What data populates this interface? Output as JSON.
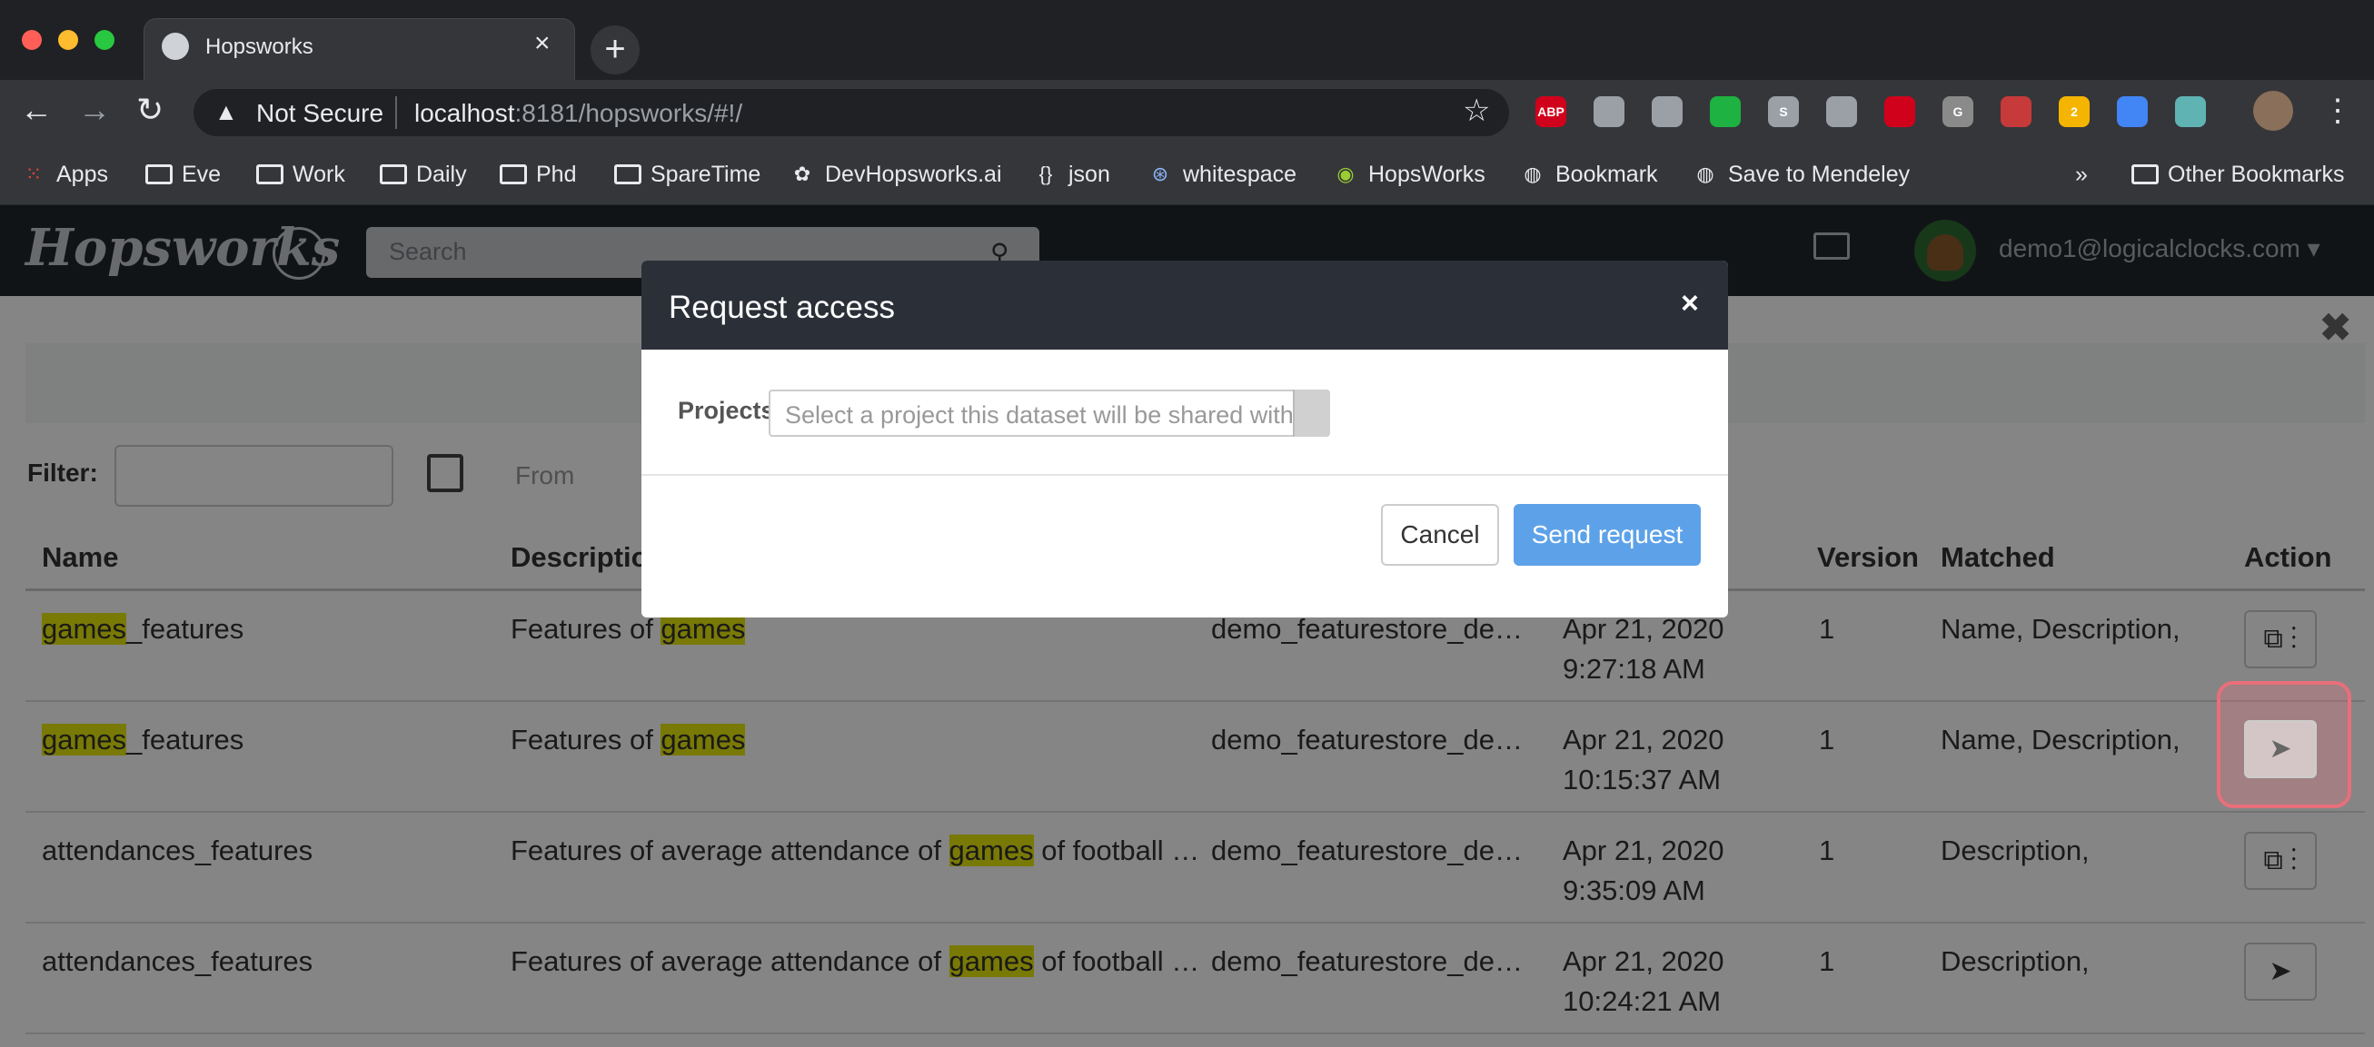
{
  "browser": {
    "tab_title": "Hopsworks",
    "tab_close": "×",
    "new_tab": "+",
    "security": "Not Secure",
    "url_host": "localhost",
    "url_path": ":8181/hopsworks/#!/",
    "extensions": [
      {
        "name": "adblock-icon",
        "text": "ABP",
        "color": "#d0021b"
      },
      {
        "name": "briefcase-icon",
        "text": "",
        "color": "#9aa0a6"
      },
      {
        "name": "dropbox-icon",
        "text": "",
        "color": "#9aa0a6"
      },
      {
        "name": "evernote-icon",
        "text": "",
        "color": "#1db241"
      },
      {
        "name": "skype-icon",
        "text": "S",
        "color": "#9aa0a6"
      },
      {
        "name": "lightbulb-icon",
        "text": "",
        "color": "#9aa0a6"
      },
      {
        "name": "mendeley-icon",
        "text": "",
        "color": "#d0021b"
      },
      {
        "name": "grammar-icon",
        "text": "G",
        "color": "#8a8a8a"
      },
      {
        "name": "tool-icon",
        "text": "",
        "color": "#c73a3a"
      },
      {
        "name": "notes-icon",
        "text": "2",
        "color": "#f4b400"
      },
      {
        "name": "shield-icon",
        "text": "",
        "color": "#4285f4"
      },
      {
        "name": "network-icon",
        "text": "",
        "color": "#5fb3b3"
      }
    ]
  },
  "bookmarks": {
    "items": [
      "Apps",
      "Eve",
      "Work",
      "Daily",
      "Phd",
      "SpareTime",
      "DevHopsworks.ai",
      "json",
      "whitespace",
      "HopsWorks",
      "Bookmark",
      "Save to Mendeley"
    ],
    "more": "»",
    "other": "Other Bookmarks"
  },
  "app": {
    "logo": "Hopsworks",
    "search_placeholder": "Search",
    "user_email": "demo1@logicalclocks.com ▾"
  },
  "filter": {
    "label": "Filter:",
    "from_placeholder": "From"
  },
  "table": {
    "headers": {
      "name": "Name",
      "description": "Description",
      "version": "Version",
      "matched": "Matched",
      "action": "Action"
    },
    "rows": [
      {
        "name_hl": "games",
        "name_rest": "_features",
        "desc_pre": "Features of ",
        "desc_hl": "games",
        "desc_post": "",
        "featurestore": "demo_featurestore_de…",
        "date": "Apr 21, 2020",
        "time": "9:27:18 AM",
        "version": "1",
        "matched": "Name, Description,",
        "action": "⧉ ⋮"
      },
      {
        "name_hl": "games",
        "name_rest": "_features",
        "desc_pre": "Features of ",
        "desc_hl": "games",
        "desc_post": "",
        "featurestore": "demo_featurestore_de…",
        "date": "Apr 21, 2020",
        "time": "10:15:37 AM",
        "version": "1",
        "matched": "Name, Description,",
        "action": "➤"
      },
      {
        "name_hl": "",
        "name_rest": "attendances_features",
        "desc_pre": "Features of average attendance of ",
        "desc_hl": "games",
        "desc_post": " of football …",
        "featurestore": "demo_featurestore_de…",
        "date": "Apr 21, 2020",
        "time": "9:35:09 AM",
        "version": "1",
        "matched": "Description,",
        "action": "⧉ ⋮"
      },
      {
        "name_hl": "",
        "name_rest": "attendances_features",
        "desc_pre": "Features of average attendance of ",
        "desc_hl": "games",
        "desc_post": " of football …",
        "featurestore": "demo_featurestore_de…",
        "date": "Apr 21, 2020",
        "time": "10:24:21 AM",
        "version": "1",
        "matched": "Description,",
        "action": "➤"
      }
    ]
  },
  "modal": {
    "title": "Request access",
    "close": "×",
    "projects_label": "Projects",
    "project_placeholder": "Select a project this dataset will be shared with",
    "cancel": "Cancel",
    "send": "Send request"
  },
  "page_close": "✖"
}
